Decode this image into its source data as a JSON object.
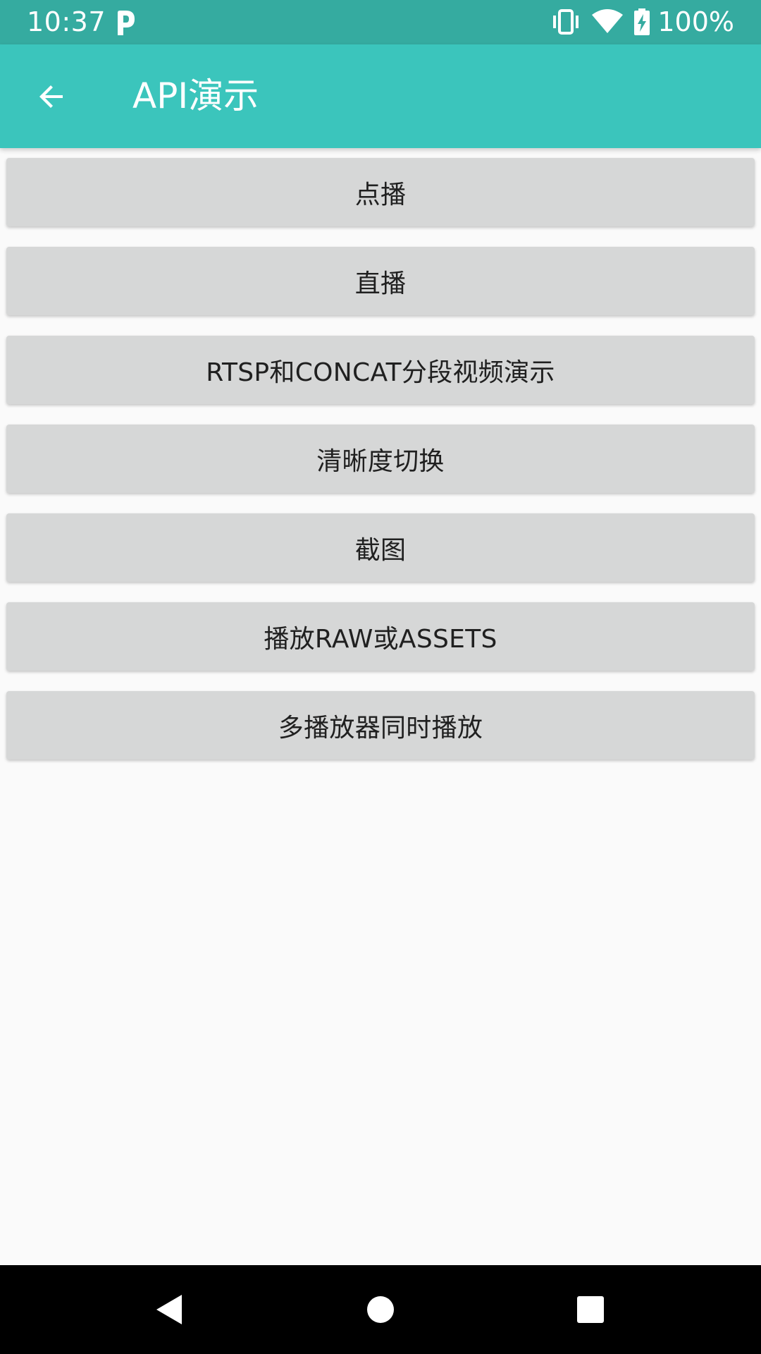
{
  "status_bar": {
    "time": "10:37",
    "battery_percent": "100%",
    "icons": [
      "p-notification-icon",
      "vibrate-icon",
      "wifi-icon",
      "battery-charging-icon"
    ]
  },
  "app_bar": {
    "title": "API演示",
    "back_icon": "arrow-back-icon"
  },
  "buttons": [
    {
      "label": "点播"
    },
    {
      "label": "直播"
    },
    {
      "label": "RTSP和CONCAT分段视频演示"
    },
    {
      "label": "清晰度切换"
    },
    {
      "label": "截图"
    },
    {
      "label": "播放RAW或ASSETS"
    },
    {
      "label": "多播放器同时播放"
    }
  ],
  "nav_bar": {
    "icons": [
      "nav-back-icon",
      "nav-home-icon",
      "nav-recents-icon"
    ]
  },
  "colors": {
    "status_bar": "#35aba0",
    "app_bar": "#3bc5bc",
    "button_bg": "#d6d7d7",
    "background": "#fafafa"
  }
}
